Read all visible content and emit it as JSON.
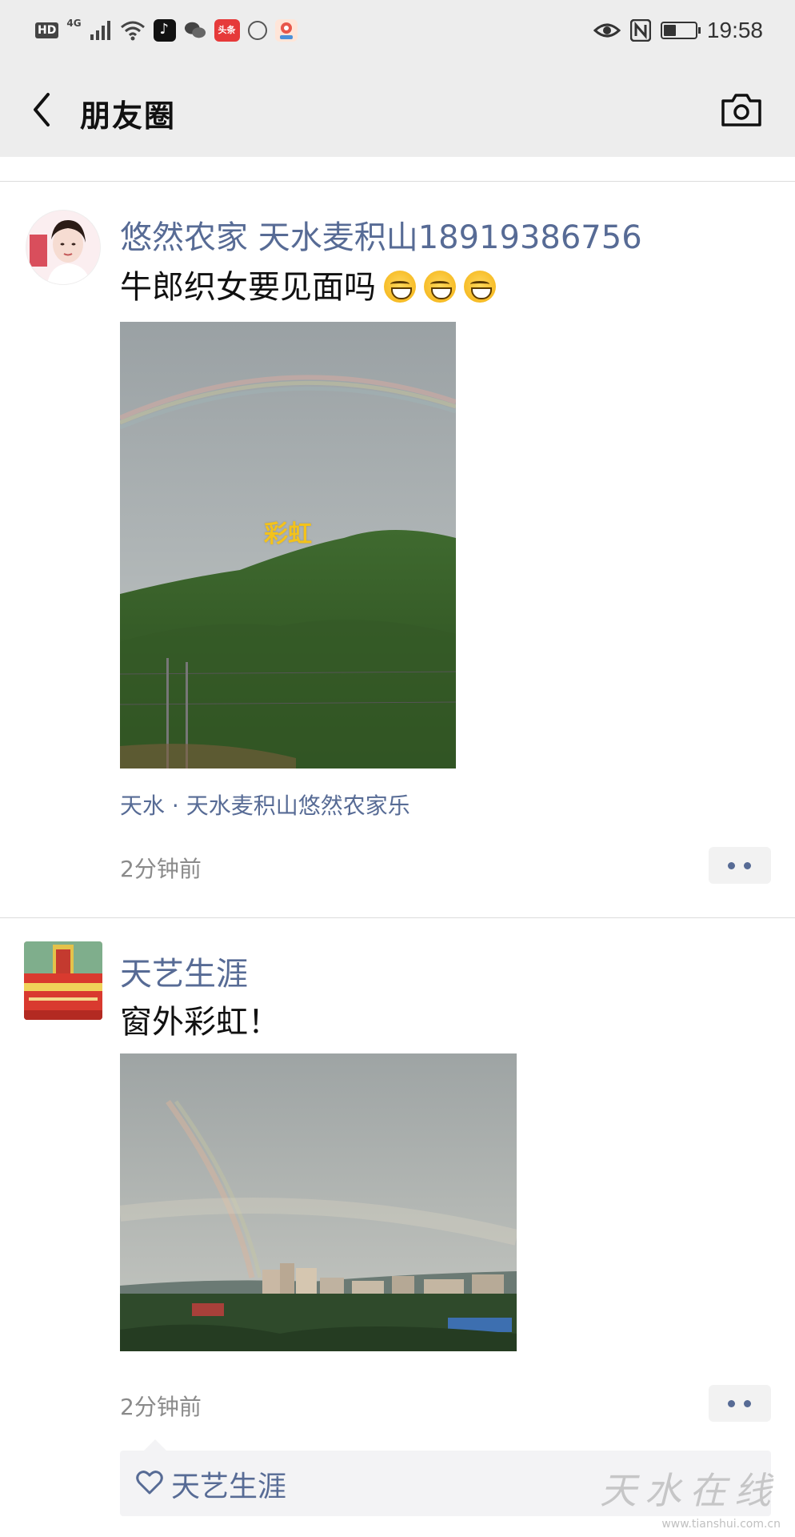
{
  "status_bar": {
    "hd": "HD",
    "network": "4G",
    "toutiao_label": "头条",
    "time": "19:58",
    "icons": [
      "hd-icon",
      "signal-icon",
      "wifi-icon",
      "tiktok-icon",
      "wechat-icon",
      "toutiao-icon",
      "browser-icon",
      "map-icon",
      "eye-icon",
      "nfc-icon",
      "battery-icon"
    ],
    "battery_level": 0.4
  },
  "nav": {
    "title": "朋友圈",
    "back_icon": "chevron-left-icon",
    "camera_icon": "camera-icon"
  },
  "posts": [
    {
      "user": "悠然农家   天水麦积山18919386756",
      "text": "牛郎织女要见面吗",
      "emoji_count": 3,
      "image_label": "彩虹",
      "location": "天水 · 天水麦积山悠然农家乐",
      "time": "2分钟前"
    },
    {
      "user": "天艺生涯",
      "text": "窗外彩虹！",
      "time": "2分钟前",
      "likes": [
        "天艺生涯"
      ]
    }
  ],
  "watermark": {
    "text": "天水在线",
    "url": "www.tianshui.com.cn"
  },
  "colors": {
    "link": "#576b95",
    "header_bg": "#ededed",
    "meta_gray": "#8a8a8a"
  }
}
